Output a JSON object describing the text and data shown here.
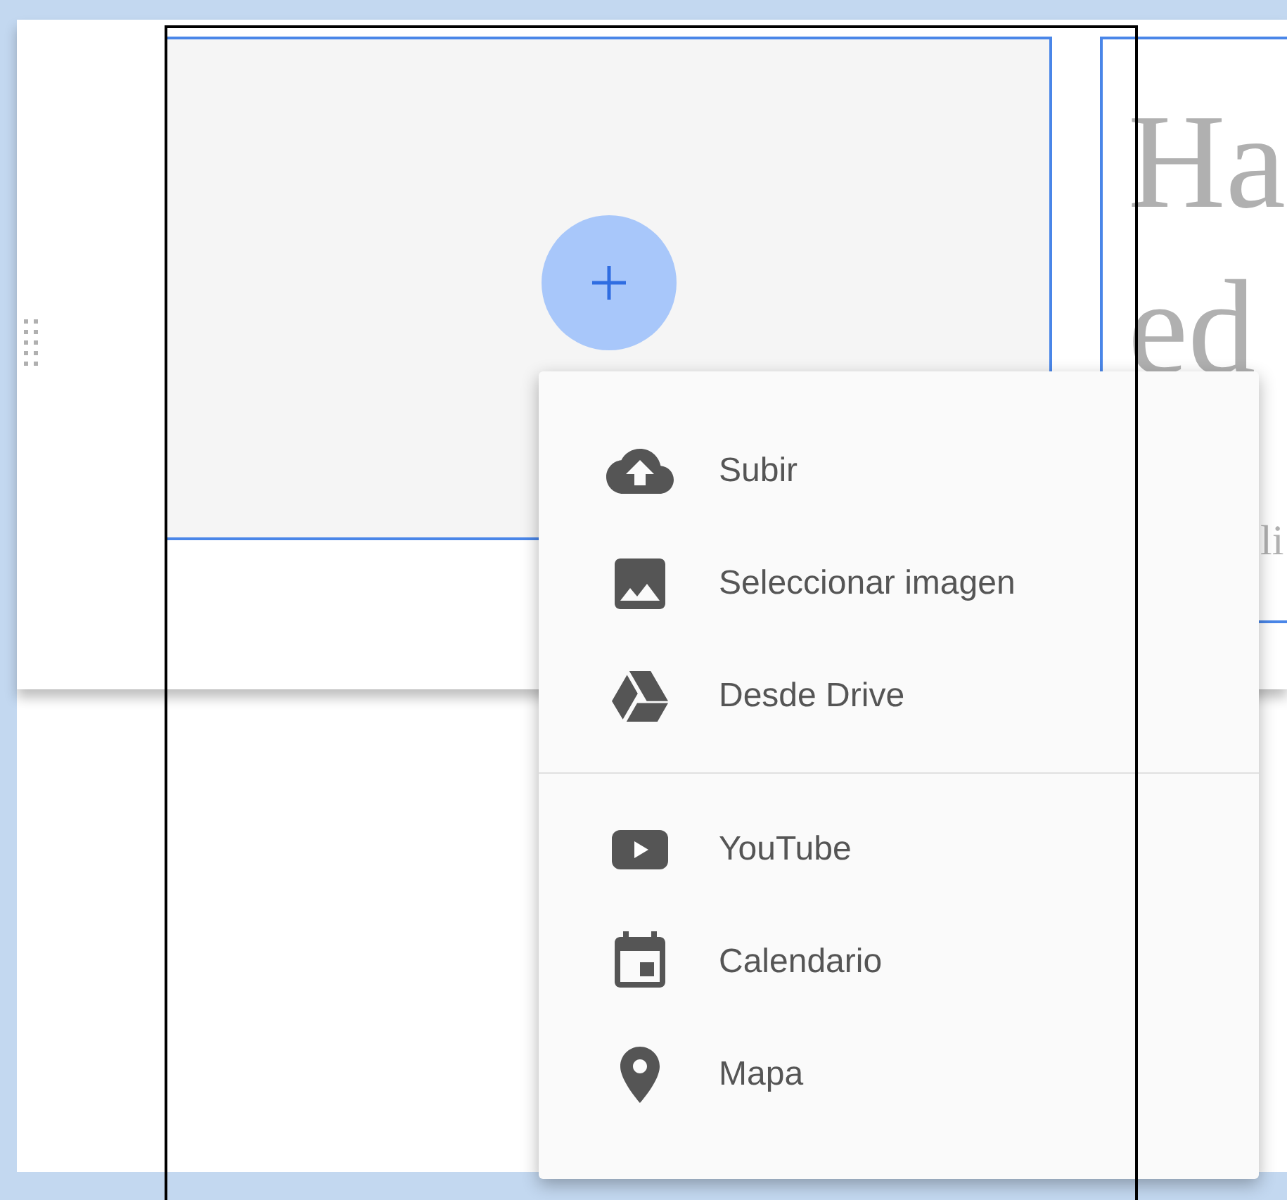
{
  "text_block": {
    "heading_lines": [
      "Ha",
      "ed"
    ],
    "body": "li"
  },
  "insert_menu": {
    "groups": [
      [
        {
          "kind": "upload",
          "label": "Subir"
        },
        {
          "kind": "image",
          "label": "Seleccionar imagen"
        },
        {
          "kind": "drive",
          "label": "Desde Drive"
        }
      ],
      [
        {
          "kind": "youtube",
          "label": "YouTube"
        },
        {
          "kind": "calendar",
          "label": "Calendario"
        },
        {
          "kind": "map",
          "label": "Mapa"
        }
      ]
    ]
  }
}
